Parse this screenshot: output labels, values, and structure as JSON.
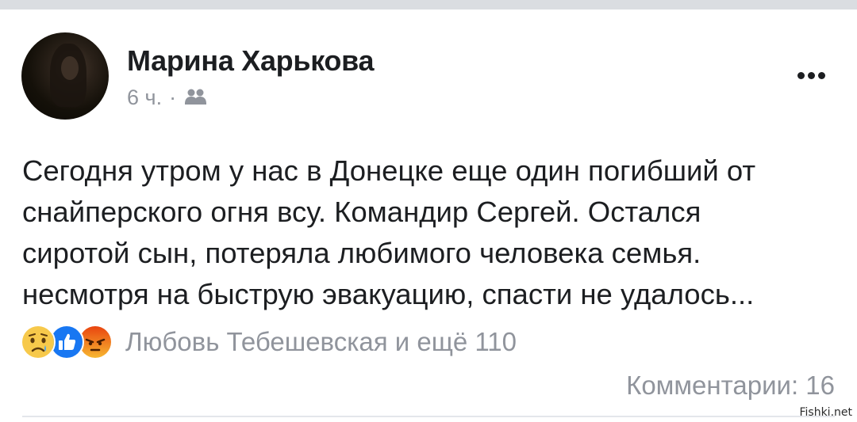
{
  "post": {
    "author": "Марина Харькова",
    "time": "6 ч.",
    "separator": "·",
    "audience_icon": "friends-icon",
    "more_icon": "more-dots-icon",
    "text_lines": [
      "Сегодня утром у нас в Донецке еще один погибший от",
      "снайперского огня всу. Командир Сергей. Остался",
      "сиротой сын, потеряла любимого человека семья.",
      "несмотря на быструю эвакуацию, спасти не удалось..."
    ],
    "reactions": {
      "icons": [
        "sad-reaction-icon",
        "like-reaction-icon",
        "angry-reaction-icon"
      ],
      "summary": "Любовь Тебешевская и ещё 110"
    },
    "comments": "Комментарии: 16"
  },
  "watermark": "Fishki.net",
  "colors": {
    "text": "#1c1e21",
    "secondary": "#90949c",
    "top_bar": "#dadde1",
    "like_blue": "#1877f2",
    "sad_yellow": "#f7c94b",
    "angry_orange": "#e9710f"
  }
}
